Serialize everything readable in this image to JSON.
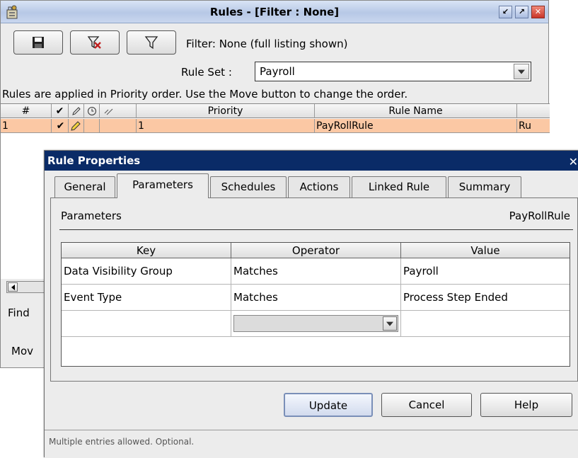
{
  "rules_window": {
    "title": "Rules - [Filter : None]",
    "filter_status": "Filter: None (full listing shown)",
    "rule_set_label": "Rule Set :",
    "rule_set_value": "Payroll",
    "info_text": "Rules are applied in Priority order.  Use the Move button to change the order.",
    "table": {
      "columns": [
        "#",
        "✔",
        "",
        "",
        "",
        "Priority",
        "Rule Name"
      ],
      "rows": [
        {
          "num": "1",
          "enabled": "✔",
          "priority": "1",
          "rule_name": "PayRollRule",
          "extra": "Ru"
        }
      ]
    },
    "find_label": "Find",
    "move_label": "Mov"
  },
  "dialog": {
    "title": "Rule Properties",
    "close_glyph": "✕",
    "tabs": [
      "General",
      "Parameters",
      "Schedules",
      "Actions",
      "Linked Rule",
      "Summary"
    ],
    "active_tab": "Parameters",
    "panel_title": "Parameters",
    "rule_name": "PayRollRule",
    "param_columns": [
      "Key",
      "Operator",
      "Value"
    ],
    "param_rows": [
      {
        "key": "Data Visibility Group",
        "operator": "Matches",
        "value": "Payroll"
      },
      {
        "key": "Event Type",
        "operator": "Matches",
        "value": "Process Step Ended"
      }
    ],
    "buttons": {
      "update": "Update",
      "cancel": "Cancel",
      "help": "Help"
    },
    "status_text": "Multiple entries allowed. Optional."
  },
  "colors": {
    "selected_row": "#fbc8a4",
    "dialog_title_bg": "#0a2b67",
    "window_bg": "#ececec"
  },
  "icons": [
    "app-icon",
    "save-icon",
    "clear-filter-icon",
    "filter-icon",
    "minimize-icon",
    "maximize-icon",
    "close-icon",
    "checkmark-icon",
    "pencil-icon",
    "clock-icon",
    "link-icon",
    "dropdown-arrow-icon"
  ]
}
